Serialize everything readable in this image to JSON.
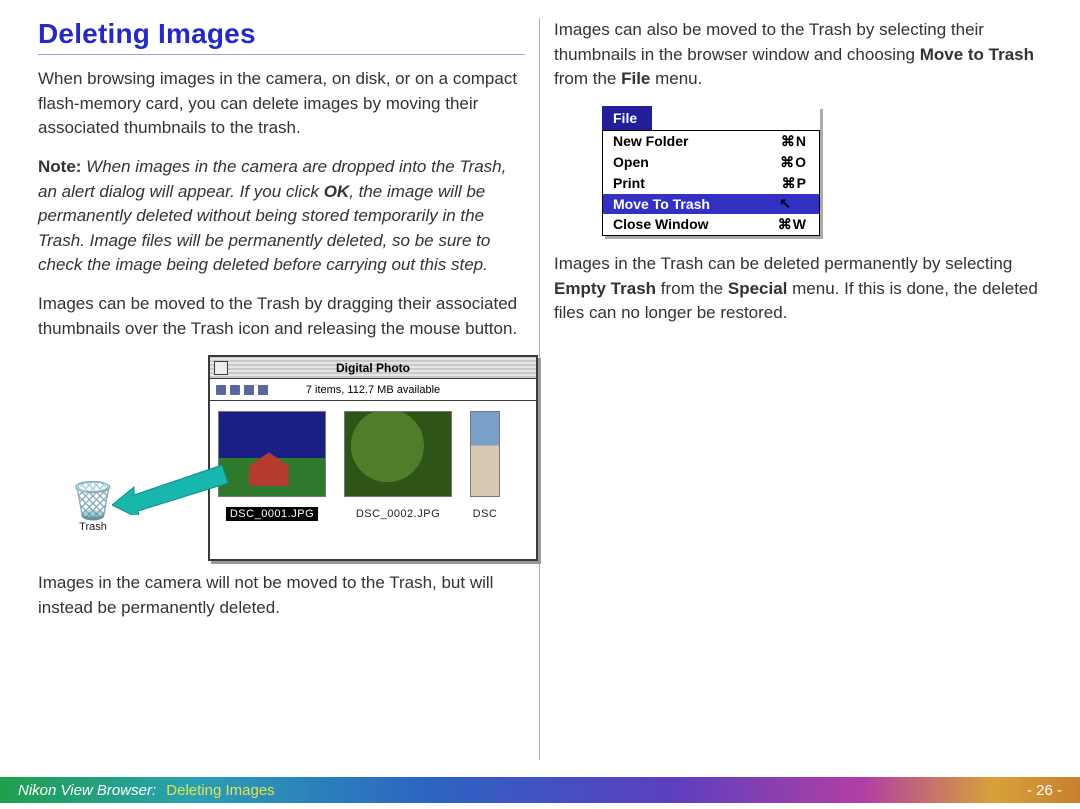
{
  "header": {
    "title": "Deleting Images"
  },
  "left": {
    "p1": "When browsing images in the camera, on disk, or on a compact flash-memory card, you can delete images by moving their associated thumbnails to the trash.",
    "note_label": "Note:",
    "note_1": " When images in the camera are dropped into the Trash, an alert dialog will appear.  If you click ",
    "note_ok": "OK",
    "note_2": ", the image will be permanently deleted without being stored temporarily in the Trash.  Image files will be permanently deleted, so be sure to check the image being deleted before carrying out this step.",
    "p2": "Images can be moved to the Trash by dragging their associated thumbnails over the Trash icon and releasing the mouse button.",
    "p3": "Images in the camera will not be moved to the Trash, but will instead be permanently deleted."
  },
  "browser": {
    "trash_label": "Trash",
    "window_title": "Digital Photo",
    "status": "7 items, 112.7 MB available",
    "thumbs": [
      {
        "label": "DSC_0001.JPG",
        "selected": true
      },
      {
        "label": "DSC_0002.JPG",
        "selected": false
      },
      {
        "label": "DSC",
        "selected": false
      }
    ]
  },
  "right": {
    "p1a": "Images can also be moved to the Trash by selecting their thumbnails in the browser window and choosing ",
    "p1b": "Move to Trash",
    "p1c": " from the ",
    "p1d": "File",
    "p1e": " menu.",
    "p2a": "Images in the Trash can be deleted permanently by selecting ",
    "p2b": "Empty Trash",
    "p2c": " from the ",
    "p2d": "Special",
    "p2e": " menu.  If this is done, the deleted files can no longer be restored."
  },
  "menu": {
    "title": "File",
    "items": [
      {
        "label": "New Folder",
        "shortcut": "⌘N",
        "selected": false
      },
      {
        "label": "Open",
        "shortcut": "⌘O",
        "selected": false
      },
      {
        "label": "Print",
        "shortcut": "⌘P",
        "selected": false
      },
      {
        "label": "Move To Trash",
        "shortcut": "",
        "selected": true
      },
      {
        "label": "Close Window",
        "shortcut": "⌘W",
        "selected": false
      }
    ]
  },
  "footer": {
    "breadcrumb_app": "Nikon View Browser:",
    "breadcrumb_section": "Deleting Images",
    "page": "- 26 -"
  }
}
